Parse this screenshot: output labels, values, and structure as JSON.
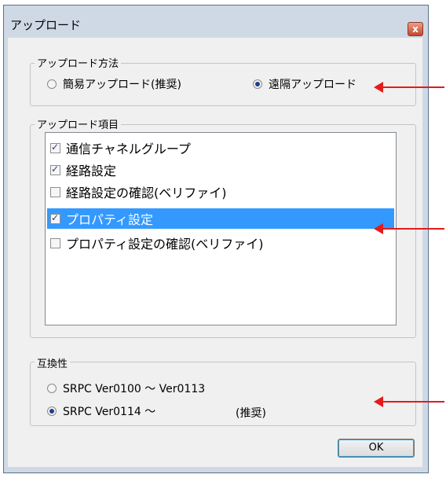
{
  "window": {
    "title": "アップロード",
    "close_label": "x"
  },
  "method_group": {
    "label": "アップロード方法",
    "options": [
      {
        "label": "簡易アップロード(推奨)",
        "selected": false
      },
      {
        "label": "遠隔アップロード",
        "selected": true
      }
    ]
  },
  "items_group": {
    "label": "アップロード項目",
    "items": [
      {
        "label": "通信チャネルグループ",
        "checked": true,
        "selected": false
      },
      {
        "label": "経路設定",
        "checked": true,
        "selected": false
      },
      {
        "label": "経路設定の確認(ベリファイ)",
        "checked": false,
        "selected": false
      },
      {
        "label": "プロパティ設定",
        "checked": true,
        "selected": true
      },
      {
        "label": "プロパティ設定の確認(ベリファイ)",
        "checked": false,
        "selected": false
      }
    ]
  },
  "compat_group": {
    "label": "互換性",
    "options": [
      {
        "label": "SRPC Ver0100 〜 Ver0113",
        "selected": false
      },
      {
        "label": "SRPC Ver0114 〜",
        "selected": true,
        "note": "(推奨)"
      }
    ]
  },
  "ok_button": {
    "label": "OK"
  },
  "colors": {
    "annotation_arrow": "#e31b1b",
    "selection": "#3399ff"
  }
}
